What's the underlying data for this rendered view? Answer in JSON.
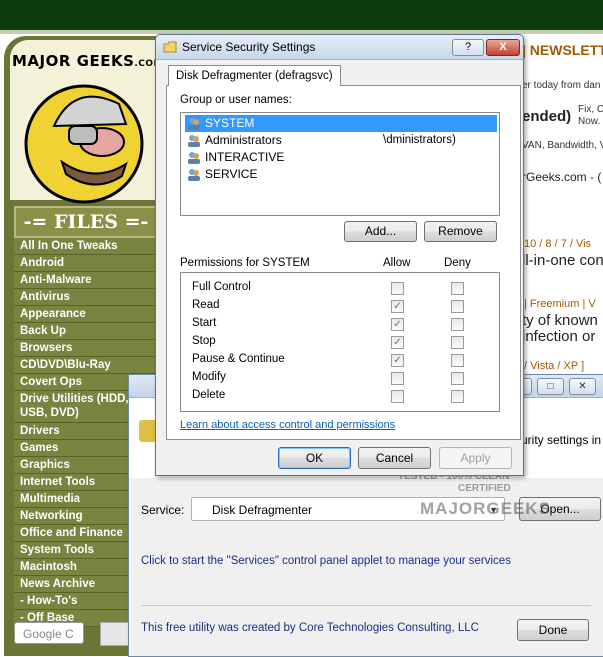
{
  "background_site": {
    "logo_text": "MAJOR GEEKS",
    "logo_suffix": ".COM",
    "newsletter": "| NEWSLETTER",
    "files_title": "-= FILES =-",
    "nav_items": [
      "All In One Tweaks",
      "Android",
      "Anti-Malware",
      "Antivirus",
      "Appearance",
      "Back Up",
      "Browsers",
      "CD\\DVD\\Blu-Ray",
      "Covert Ops",
      "Drive Utilities (HDD, USB, DVD)",
      "Drivers",
      "Games",
      "Graphics",
      "Internet Tools",
      "Multimedia",
      "Networking",
      "Office and Finance",
      "System Tools",
      "Macintosh",
      "News Archive",
      "- How-To's",
      "- Off Base"
    ],
    "search_placeholder": "Google C",
    "right_snippets": {
      "s1": "er today from dan",
      "s2": "ended)",
      "s3": "Fix, C",
      "s4": "Now.",
      "s5": "VAN, Bandwidth, V",
      "s6": "rGeeks.com - (",
      "s7": "10 / 8 / 7 / Vis",
      "s8": "ll-in-one con",
      "s9": "| Freemium | V",
      "s10": "ty of known",
      "s11": "infection or",
      "s12": "/ Vista / XP ]"
    },
    "stamp": {
      "line1": "TESTED • 100% CLEAN",
      "line2": "MAJORGEEKS",
      "line3": "CERTIFIED"
    }
  },
  "service_window": {
    "description_tail": "urity settings in",
    "service_label": "Service:",
    "service_value": "Disk Defragmenter",
    "open_button": "Open...",
    "hint": "Click to start the \"Services\" control panel applet to manage your services",
    "credit": "This free utility was created by Core Technologies Consulting, LLC",
    "done_button": "Done",
    "ctl_min": "–",
    "ctl_max": "□",
    "ctl_close": "✕"
  },
  "dialog": {
    "title": "Service Security Settings",
    "help_button": "?",
    "close_button": "X",
    "tab_label": "Disk Defragmenter (defragsvc)",
    "group_label": "Group or user names:",
    "users": [
      {
        "name": "SYSTEM",
        "suffix": "",
        "selected": true
      },
      {
        "name": "Administrators",
        "suffix": "\\dministrators)",
        "selected": false
      },
      {
        "name": "INTERACTIVE",
        "suffix": "",
        "selected": false
      },
      {
        "name": "SERVICE",
        "suffix": "",
        "selected": false
      }
    ],
    "add_button": "Add...",
    "remove_button": "Remove",
    "permissions_title": "Permissions for SYSTEM",
    "allow_header": "Allow",
    "deny_header": "Deny",
    "permissions": [
      {
        "name": "Full Control",
        "allow": false,
        "deny": false
      },
      {
        "name": "Read",
        "allow": true,
        "deny": false
      },
      {
        "name": "Start",
        "allow": true,
        "deny": false
      },
      {
        "name": "Stop",
        "allow": true,
        "deny": false
      },
      {
        "name": "Pause & Continue",
        "allow": true,
        "deny": false
      },
      {
        "name": "Modify",
        "allow": false,
        "deny": false
      },
      {
        "name": "Delete",
        "allow": false,
        "deny": false
      }
    ],
    "learn_link": "Learn about access control and permissions",
    "ok_button": "OK",
    "cancel_button": "Cancel",
    "apply_button": "Apply"
  }
}
